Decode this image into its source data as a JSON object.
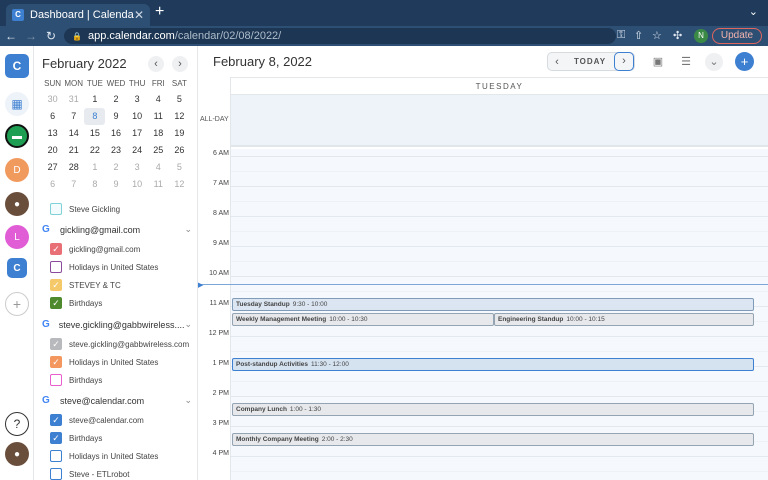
{
  "browser": {
    "tab_title": "Dashboard | Calendar",
    "tab_favicon": "C",
    "url_host": "app.calendar.com",
    "url_path": "/calendar/02/08/2022/",
    "profile_initial": "N",
    "update_label": "Update"
  },
  "rail": {
    "avatar_d": "D",
    "avatar_l": "L",
    "app_letter": "C"
  },
  "sidebar": {
    "month_title": "February 2022",
    "weekdays": [
      "SUN",
      "MON",
      "TUE",
      "WED",
      "THU",
      "FRI",
      "SAT"
    ],
    "weeks": [
      [
        "30",
        "31",
        "1",
        "2",
        "3",
        "4",
        "5"
      ],
      [
        "6",
        "7",
        "8",
        "9",
        "10",
        "11",
        "12"
      ],
      [
        "13",
        "14",
        "15",
        "16",
        "17",
        "18",
        "19"
      ],
      [
        "20",
        "21",
        "22",
        "23",
        "24",
        "25",
        "26"
      ],
      [
        "27",
        "28",
        "1",
        "2",
        "3",
        "4",
        "5"
      ],
      [
        "6",
        "7",
        "8",
        "9",
        "10",
        "11",
        "12"
      ]
    ],
    "personal_calendar": "Steve Gickling",
    "groups": [
      {
        "account": "gickling@gmail.com",
        "items": [
          "gickling@gmail.com",
          "Holidays in United States",
          "STEVEY & TC",
          "Birthdays"
        ]
      },
      {
        "account": "steve.gickling@gabbwireless....",
        "items": [
          "steve.gickling@gabbwireless.com",
          "Holidays in United States",
          "Birthdays"
        ]
      },
      {
        "account": "steve@calendar.com",
        "items": [
          "steve@calendar.com",
          "Birthdays",
          "Holidays in United States",
          "Steve - ETLrobot"
        ]
      }
    ]
  },
  "main": {
    "date_title": "February 8, 2022",
    "today_label": "TODAY",
    "day_label": "TUESDAY",
    "allday_label": "ALL-DAY",
    "hours": [
      "6 AM",
      "7 AM",
      "8 AM",
      "9 AM",
      "10 AM",
      "11 AM",
      "12 PM",
      "1 PM",
      "2 PM",
      "3 PM",
      "4 PM"
    ],
    "events": [
      {
        "title": "Tuesday Standup",
        "time": "9:30 - 10:00"
      },
      {
        "title": "Weekly Management Meeting",
        "time": "10:00 - 10:30"
      },
      {
        "title": "Engineering Standup",
        "time": "10:00 - 10:15"
      },
      {
        "title": "Post-standup Activities",
        "time": "11:30 - 12:00"
      },
      {
        "title": "Company Lunch",
        "time": "1:00 - 1:30"
      },
      {
        "title": "Monthly Company Meeting",
        "time": "2:00 - 2:30"
      }
    ]
  },
  "colors": {
    "accent": "#3d7fd1",
    "chrome": "#1f3a5a",
    "allday_bg": "#eef3f9"
  }
}
